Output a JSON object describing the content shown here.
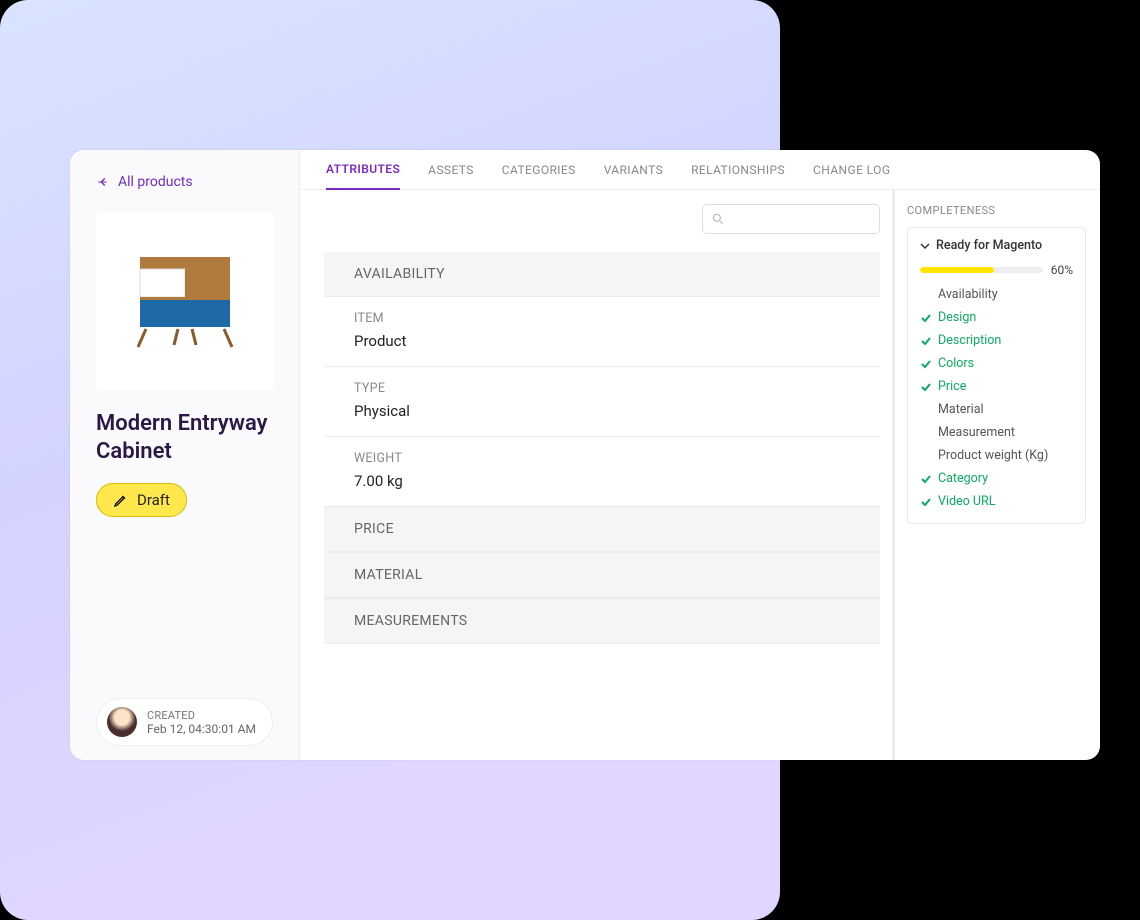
{
  "sidebar": {
    "back_label": "All products",
    "product_title": "Modern Entryway Cabinet",
    "status_label": "Draft",
    "created_label": "CREATED",
    "created_date": "Feb 12, 04:30:01 AM"
  },
  "tabs": [
    "ATTRIBUTES",
    "ASSETS",
    "CATEGORIES",
    "VARIANTS",
    "RELATIONSHIPS",
    "CHANGE LOG"
  ],
  "active_tab": 0,
  "attributes": {
    "sections": [
      {
        "header": "AVAILABILITY",
        "fields": [
          {
            "label": "ITEM",
            "value": "Product"
          },
          {
            "label": "TYPE",
            "value": "Physical"
          },
          {
            "label": "WEIGHT",
            "value": "7.00 kg"
          }
        ]
      },
      {
        "header": "PRICE",
        "fields": []
      },
      {
        "header": "MATERIAL",
        "fields": []
      },
      {
        "header": "MEASUREMENTS",
        "fields": []
      }
    ]
  },
  "completeness": {
    "title": "COMPLETENESS",
    "group_label": "Ready for Magento",
    "percent": 60,
    "items": [
      {
        "label": "Availability",
        "done": false
      },
      {
        "label": "Design",
        "done": true
      },
      {
        "label": "Description",
        "done": true
      },
      {
        "label": "Colors",
        "done": true
      },
      {
        "label": "Price",
        "done": true
      },
      {
        "label": "Material",
        "done": false
      },
      {
        "label": "Measurement",
        "done": false
      },
      {
        "label": "Product weight (Kg)",
        "done": false
      },
      {
        "label": "Category",
        "done": true
      },
      {
        "label": "Video URL",
        "done": true
      }
    ]
  }
}
